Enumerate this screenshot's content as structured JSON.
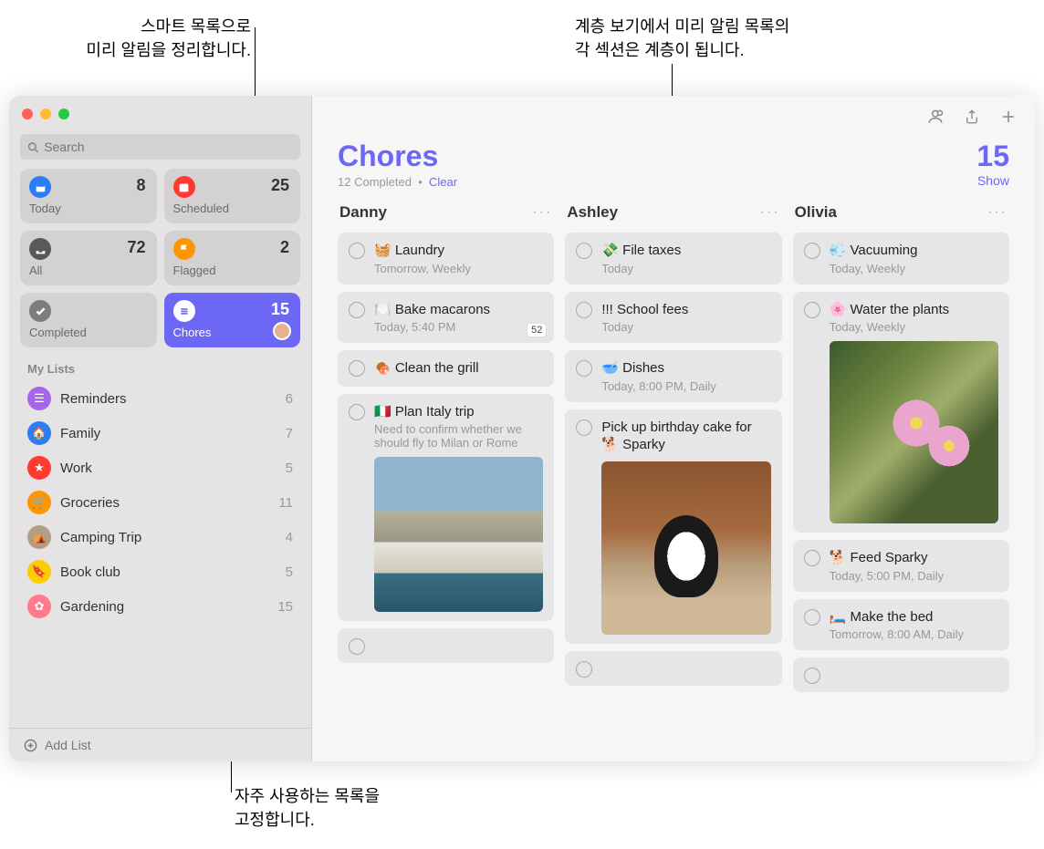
{
  "callouts": {
    "top_left": "스마트 목록으로\n미리 알림을 정리합니다.",
    "top_right": "계층 보기에서 미리 알림 목록의\n각 섹션은 계층이 됩니다.",
    "bottom": "자주 사용하는 목록을\n고정합니다."
  },
  "sidebar": {
    "search_placeholder": "Search",
    "smart": [
      {
        "label": "Today",
        "count": "8",
        "color": "#2a7df6",
        "icon": "calendar"
      },
      {
        "label": "Scheduled",
        "count": "25",
        "color": "#ff3b30",
        "icon": "calendar-grid"
      },
      {
        "label": "All",
        "count": "72",
        "color": "#595959",
        "icon": "tray"
      },
      {
        "label": "Flagged",
        "count": "2",
        "color": "#ff9500",
        "icon": "flag"
      },
      {
        "label": "Completed",
        "count": "",
        "color": "#7d7d7d",
        "icon": "check"
      },
      {
        "label": "Chores",
        "count": "15",
        "color": "#6c68f5",
        "icon": "list",
        "active": true
      }
    ],
    "my_lists_header": "My Lists",
    "lists": [
      {
        "label": "Reminders",
        "count": "6",
        "color": "#a665ea"
      },
      {
        "label": "Family",
        "count": "7",
        "color": "#2a7df6"
      },
      {
        "label": "Work",
        "count": "5",
        "color": "#ff3b30"
      },
      {
        "label": "Groceries",
        "count": "11",
        "color": "#ff9500"
      },
      {
        "label": "Camping Trip",
        "count": "4",
        "color": "#b39e84"
      },
      {
        "label": "Book club",
        "count": "5",
        "color": "#ffcc00"
      },
      {
        "label": "Gardening",
        "count": "15",
        "color": "#ff7a8a"
      }
    ],
    "add_list": "Add List"
  },
  "header": {
    "title": "Chores",
    "completed_text": "12 Completed",
    "dot": "•",
    "clear": "Clear",
    "count": "15",
    "show": "Show"
  },
  "columns": [
    {
      "name": "Danny",
      "cards": [
        {
          "title": "🧺 Laundry",
          "sub": "Tomorrow, Weekly"
        },
        {
          "title": "🍽️ Bake macarons",
          "sub": "Today, 5:40 PM",
          "badge": "52"
        },
        {
          "title": "🍖 Clean the grill"
        },
        {
          "title": "🇮🇹 Plan Italy trip",
          "sub": "Need to confirm whether we should fly to Milan or Rome",
          "image": "cliff"
        }
      ]
    },
    {
      "name": "Ashley",
      "cards": [
        {
          "title": "💸 File taxes",
          "sub": "Today"
        },
        {
          "title": "!!! School fees",
          "sub": "Today"
        },
        {
          "title": "🥣 Dishes",
          "sub": "Today, 8:00 PM, Daily"
        },
        {
          "title": "Pick up birthday cake for 🐕 Sparky",
          "image": "dog"
        }
      ]
    },
    {
      "name": "Olivia",
      "cards": [
        {
          "title": "💨 Vacuuming",
          "sub": "Today, Weekly"
        },
        {
          "title": "🌸 Water the plants",
          "sub": "Today, Weekly",
          "image": "flower"
        },
        {
          "title": "🐕 Feed Sparky",
          "sub": "Today, 5:00 PM, Daily"
        },
        {
          "title": "🛏️ Make the bed",
          "sub": "Tomorrow, 8:00 AM, Daily"
        }
      ]
    }
  ]
}
